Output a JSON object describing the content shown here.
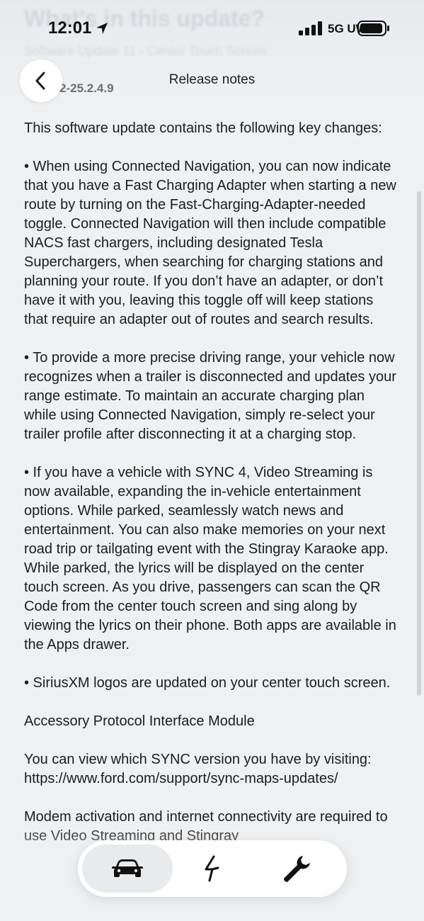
{
  "status_bar": {
    "time": "12:01",
    "network": "5G UW"
  },
  "background": {
    "title": "What's in this update?",
    "subtitle": "Software Update 11 - Center Touch Screen",
    "version": "2-25.2.4.9"
  },
  "header": {
    "title": "Release notes",
    "back_icon": "chevron-left-icon"
  },
  "content": {
    "intro": "This software update contains the following key changes:",
    "bullets": [
      "• When using Connected Navigation, you can now indicate that you have a Fast Charging Adapter when starting a new route by turning on the Fast-Charging-Adapter-needed toggle. Connected Navigation will then include compatible NACS fast chargers, including designated Tesla Superchargers, when searching for charging stations and planning your route. If you don’t have an adapter, or don’t have it with you, leaving this toggle off will keep stations that require an adapter out of routes and search results.",
      "• To provide a more precise driving range, your vehicle now recognizes when a trailer is disconnected and updates your range estimate. To maintain an accurate charging plan while using Connected Navigation, simply re-select your trailer profile after disconnecting it at a charging stop.",
      "• If you have a vehicle with SYNC 4, Video Streaming is now available, expanding the in-vehicle entertainment options. While parked, seamlessly watch news and entertainment. You can also make memories on your next road trip or tailgating event with the Stingray Karaoke app. While parked, the lyrics will be displayed on the center touch screen. As you drive, passengers can scan the QR Code from the center touch screen and sing along by viewing the lyrics on their phone. Both apps are available in the Apps drawer.",
      "• SiriusXM logos are updated on your center touch screen."
    ],
    "module": "Accessory Protocol Interface Module",
    "sync_note": "You can view which SYNC version you have by visiting: https://www.ford.com/support/sync-maps-updates/",
    "modem_note": "Modem activation and internet connectivity are required to use Video Streaming and Stingray"
  },
  "tabbar": {
    "tabs": [
      {
        "name": "vehicle",
        "icon": "car-icon",
        "active": true
      },
      {
        "name": "charging",
        "icon": "lightning-icon",
        "active": false
      },
      {
        "name": "service",
        "icon": "wrench-icon",
        "active": false
      }
    ]
  },
  "colors": {
    "background": "#eef0f2",
    "text": "#1b1d20",
    "tabbar": "#ffffff",
    "active_tab": "#e9eaec"
  }
}
